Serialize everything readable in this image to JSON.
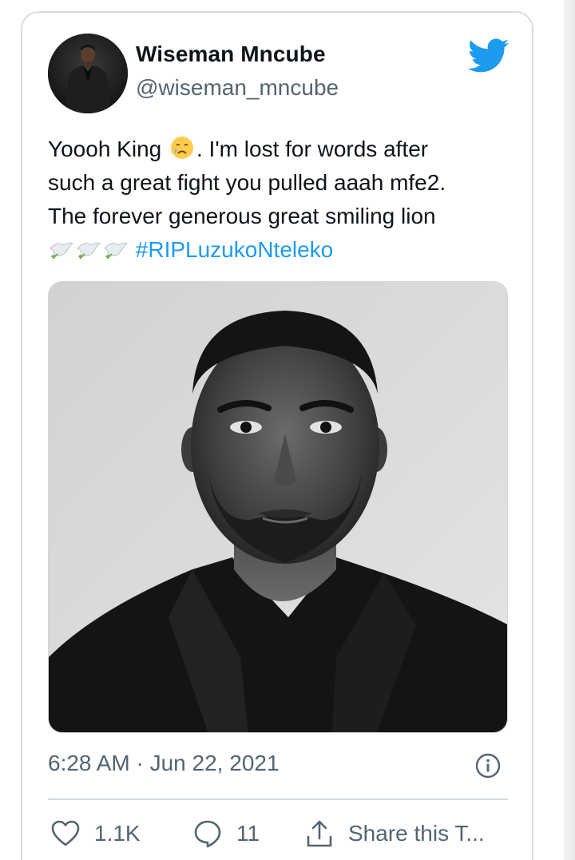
{
  "tweet": {
    "author_name": "Wiseman Mncube",
    "author_handle": "@wiseman_mncube",
    "text_line1_a": "Yoooh King ",
    "text_line1_b": ". I'm lost for words after",
    "text_line2": "such a great fight you pulled aaah mfe2.",
    "text_line3": "The forever generous great smiling lion",
    "hashtag": "#RIPLuzukoNteleko",
    "emojis": [
      "crying-face-emoji",
      "dove-emoji",
      "dove-emoji",
      "dove-emoji"
    ],
    "timestamp": "6:28 AM · Jun 22, 2021"
  },
  "actions": {
    "like_count": "1.1K",
    "reply_count": "11",
    "share_label": "Share this T..."
  },
  "colors": {
    "twitter_blue": "#1d9bf0",
    "text_primary": "#0f1419",
    "text_secondary": "#536471",
    "border": "#cfd9de"
  }
}
